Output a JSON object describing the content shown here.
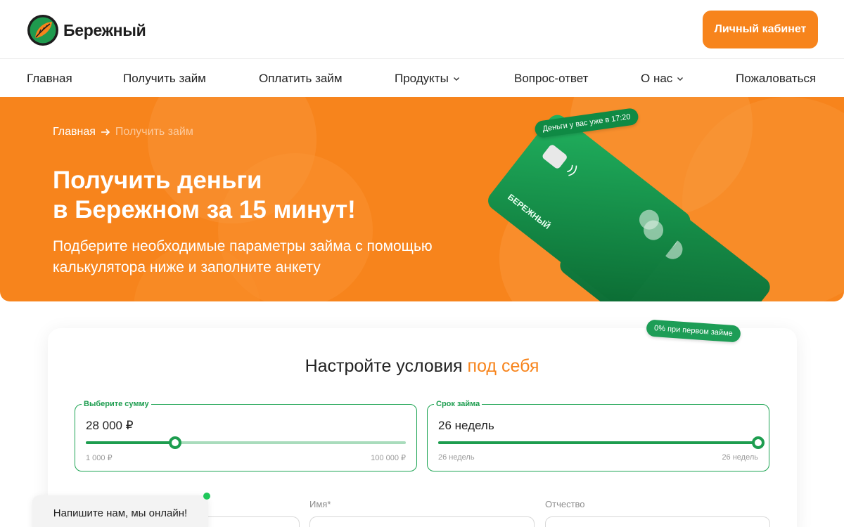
{
  "brand": {
    "name": "Бережный",
    "accent": "#f7841c",
    "green": "#1d9d4f"
  },
  "header": {
    "cabinet_label": "Личный кабинет"
  },
  "nav": {
    "items": [
      {
        "label": "Главная"
      },
      {
        "label": "Получить займ"
      },
      {
        "label": "Оплатить займ"
      },
      {
        "label": "Продукты",
        "icon": "chevron-down-icon"
      },
      {
        "label": "Вопрос-ответ"
      },
      {
        "label": "О нас",
        "icon": "chevron-down-icon"
      },
      {
        "label": "Пожаловаться"
      }
    ]
  },
  "hero": {
    "breadcrumb": {
      "home": "Главная",
      "current": "Получить займ"
    },
    "title_line1": "Получить деньги",
    "title_line2": "в Бережном за 15 минут!",
    "subtitle": "Подберите необходимые параметры займа с помощью калькулятора ниже и заполните анкету",
    "time_badge": "Деньги у вас уже в 17:20",
    "card_brand": "БЕРЕЖНЫЙ"
  },
  "calculator": {
    "promo_badge": "0% при первом займе",
    "title_main": "Настройте условия",
    "title_accent": "под себя",
    "amount": {
      "label": "Выберите сумму",
      "value": "28 000 ₽",
      "min": "1 000 ₽",
      "max": "100 000 ₽",
      "position": 0.28
    },
    "term": {
      "label": "Срок займа",
      "value": "26 недель",
      "min": "26 недель",
      "max": "26 недель",
      "position": 1.0
    },
    "form": {
      "name_label": "Имя*",
      "patronymic_label": "Отчество"
    }
  },
  "chat": {
    "label": "Напишите нам, мы онлайн!",
    "status_color": "#1fc75a"
  }
}
